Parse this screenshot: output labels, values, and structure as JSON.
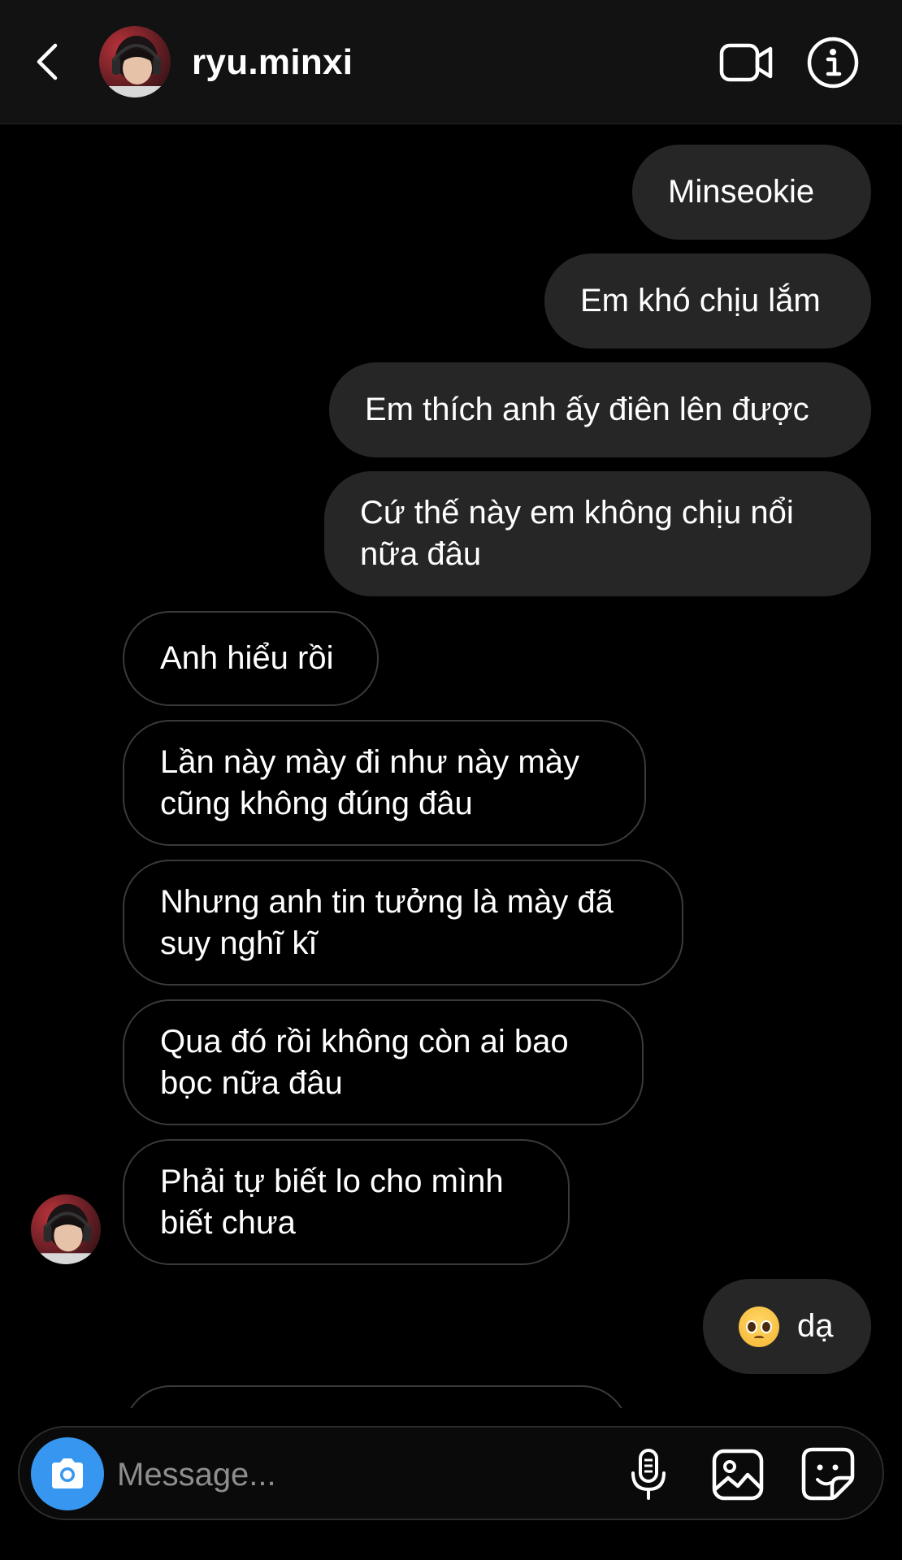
{
  "header": {
    "username": "ryu.minxi",
    "back_icon": "chevron-left-icon",
    "video_icon": "video-camera-icon",
    "info_icon": "info-icon"
  },
  "messages": [
    {
      "direction": "sent",
      "text": "Minseokie"
    },
    {
      "direction": "sent",
      "text": "Em khó chịu lắm"
    },
    {
      "direction": "sent",
      "text": "Em thích anh ấy điên lên được"
    },
    {
      "direction": "sent",
      "text": "Cứ thế này em không chịu nổi\nnữa đâu"
    },
    {
      "direction": "received",
      "text": "Anh hiểu rồi"
    },
    {
      "direction": "received",
      "text": "Lần này mày đi như này mày\ncũng không đúng đâu"
    },
    {
      "direction": "received",
      "text": "Nhưng anh tin tưởng là mày đã\nsuy nghĩ kĩ"
    },
    {
      "direction": "received",
      "text": "Qua đó rồi không còn ai bao\nbọc nữa đâu"
    },
    {
      "direction": "received",
      "text": "Phải tự biết lo cho mình\nbiết chưa"
    },
    {
      "direction": "sent",
      "text": "dạ",
      "emoji": "pleading-face-emoji"
    }
  ],
  "composer": {
    "placeholder": "Message...",
    "camera_icon": "camera-icon",
    "mic_icon": "microphone-icon",
    "gallery_icon": "gallery-icon",
    "sticker_icon": "sticker-icon"
  },
  "colors": {
    "background": "#000000",
    "header_bg": "#121212",
    "sent_bubble": "#262626",
    "received_border": "#3a3a3a",
    "accent_blue": "#3797f0",
    "placeholder": "#8e8e8e"
  }
}
